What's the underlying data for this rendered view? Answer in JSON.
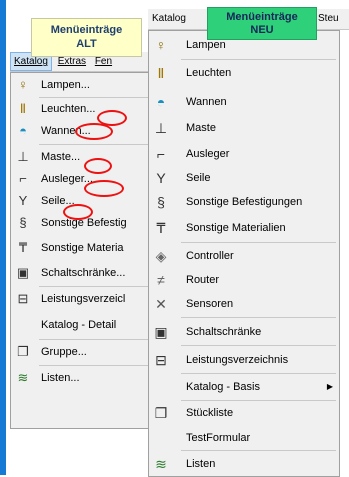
{
  "old": {
    "label_line1": "Menüeinträge",
    "label_line2": "ALT",
    "menubar": [
      "Katalog",
      "Extras",
      "Fen"
    ],
    "items": [
      {
        "label": "Lampen...",
        "icon": "lamp-icon"
      },
      {
        "label": "Leuchten...",
        "icon": "luminaire-icon"
      },
      {
        "label": "Wannen...",
        "icon": "trough-icon"
      },
      {
        "label": "Maste...",
        "icon": "mast-icon"
      },
      {
        "label": "Ausleger...",
        "icon": "bracket-icon"
      },
      {
        "label": "Seile...",
        "icon": "rope-icon"
      },
      {
        "label": "Sonstige Befestig",
        "icon": "fastening-icon"
      },
      {
        "label": "Sonstige Materia",
        "icon": "material-icon"
      },
      {
        "label": "Schaltschränke...",
        "icon": "cabinet-icon"
      },
      {
        "label": "Leistungsverzeicl",
        "icon": "service-list-icon"
      },
      {
        "label": "Katalog - Detail",
        "icon": ""
      },
      {
        "label": "Gruppe...",
        "icon": "group-icon"
      },
      {
        "label": "Listen...",
        "icon": "list-icon"
      }
    ]
  },
  "new": {
    "label_line1": "Menüeinträge",
    "label_line2": "NEU",
    "menubar": [
      "Katalog",
      "Steu"
    ],
    "items": [
      {
        "label": "Lampen",
        "icon": "lamp-icon"
      },
      {
        "label": "Leuchten",
        "icon": "luminaire-icon"
      },
      {
        "label": "Wannen",
        "icon": "trough-icon"
      },
      {
        "label": "Maste",
        "icon": "mast-icon"
      },
      {
        "label": "Ausleger",
        "icon": "bracket-icon"
      },
      {
        "label": "Seile",
        "icon": "rope-icon"
      },
      {
        "label": "Sonstige Befestigungen",
        "icon": "fastening-icon"
      },
      {
        "label": "Sonstige Materialien",
        "icon": "material-icon"
      },
      {
        "label": "Controller",
        "icon": "controller-icon"
      },
      {
        "label": "Router",
        "icon": "router-icon"
      },
      {
        "label": "Sensoren",
        "icon": "sensor-icon"
      },
      {
        "label": "Schaltschränke",
        "icon": "cabinet-icon"
      },
      {
        "label": "Leistungsverzeichnis",
        "icon": "service-list-icon"
      },
      {
        "label": "Katalog - Basis",
        "icon": ""
      },
      {
        "label": "Stückliste",
        "icon": "parts-list-icon"
      },
      {
        "label": "TestFormular",
        "icon": ""
      },
      {
        "label": "Listen",
        "icon": "list-icon"
      }
    ]
  },
  "colors": {
    "old_label_bg": "#ffffc8",
    "new_label_bg": "#2fd07a",
    "ring": "#ee1111",
    "menu_bg": "#f0f0f0",
    "side_bar": "#1679d4"
  }
}
